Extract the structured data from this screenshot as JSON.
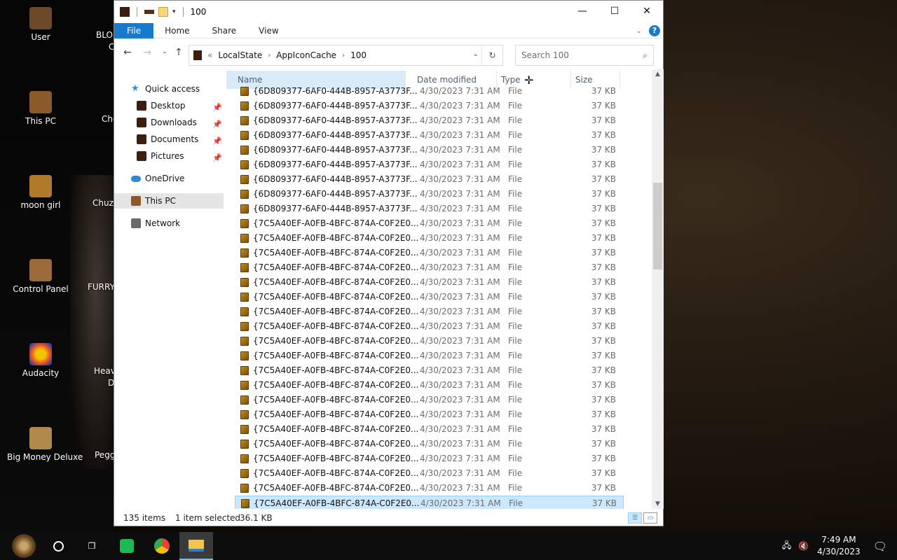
{
  "desktop": {
    "icons": [
      {
        "label": "User",
        "color": "#6b4a2a"
      },
      {
        "label": "This PC",
        "color": "#8b5a2b"
      },
      {
        "label": "moon girl",
        "color": "#b07a2a"
      },
      {
        "label": "Control Panel",
        "color": "#9a6a3a"
      },
      {
        "label": "Audacity",
        "color": "#e2502a"
      },
      {
        "label": "Big Money Deluxe",
        "color": "#b08a4a"
      }
    ],
    "clipped": [
      "BLO",
      "C",
      "Cho",
      "Chuzz",
      "FURRY",
      "Heav",
      "D",
      "Pegg"
    ]
  },
  "window": {
    "title": "100",
    "ribbon_tabs": {
      "file": "File",
      "home": "Home",
      "share": "Share",
      "view": "View"
    },
    "help": "?",
    "address": {
      "prefix": "«",
      "crumbs": [
        "LocalState",
        "AppIconCache",
        "100"
      ]
    },
    "search_placeholder": "Search 100",
    "nav": {
      "quick_access": "Quick access",
      "desktop": "Desktop",
      "downloads": "Downloads",
      "documents": "Documents",
      "pictures": "Pictures",
      "onedrive": "OneDrive",
      "this_pc": "This PC",
      "network": "Network"
    },
    "columns": {
      "name": "Name",
      "date": "Date modified",
      "type": "Type",
      "size": "Size"
    },
    "rows": [
      {
        "name": "{6D809377-6AF0-444B-8957-A3773F...",
        "date": "4/30/2023 7:31 AM",
        "type": "File",
        "size": "37 KB"
      },
      {
        "name": "{6D809377-6AF0-444B-8957-A3773F...",
        "date": "4/30/2023 7:31 AM",
        "type": "File",
        "size": "37 KB"
      },
      {
        "name": "{6D809377-6AF0-444B-8957-A3773F...",
        "date": "4/30/2023 7:31 AM",
        "type": "File",
        "size": "37 KB"
      },
      {
        "name": "{6D809377-6AF0-444B-8957-A3773F...",
        "date": "4/30/2023 7:31 AM",
        "type": "File",
        "size": "37 KB"
      },
      {
        "name": "{6D809377-6AF0-444B-8957-A3773F...",
        "date": "4/30/2023 7:31 AM",
        "type": "File",
        "size": "37 KB"
      },
      {
        "name": "{6D809377-6AF0-444B-8957-A3773F...",
        "date": "4/30/2023 7:31 AM",
        "type": "File",
        "size": "37 KB"
      },
      {
        "name": "{6D809377-6AF0-444B-8957-A3773F...",
        "date": "4/30/2023 7:31 AM",
        "type": "File",
        "size": "37 KB"
      },
      {
        "name": "{6D809377-6AF0-444B-8957-A3773F...",
        "date": "4/30/2023 7:31 AM",
        "type": "File",
        "size": "37 KB"
      },
      {
        "name": "{6D809377-6AF0-444B-8957-A3773F...",
        "date": "4/30/2023 7:31 AM",
        "type": "File",
        "size": "37 KB"
      },
      {
        "name": "{7C5A40EF-A0FB-4BFC-874A-C0F2E0...",
        "date": "4/30/2023 7:31 AM",
        "type": "File",
        "size": "37 KB"
      },
      {
        "name": "{7C5A40EF-A0FB-4BFC-874A-C0F2E0...",
        "date": "4/30/2023 7:31 AM",
        "type": "File",
        "size": "37 KB"
      },
      {
        "name": "{7C5A40EF-A0FB-4BFC-874A-C0F2E0...",
        "date": "4/30/2023 7:31 AM",
        "type": "File",
        "size": "37 KB"
      },
      {
        "name": "{7C5A40EF-A0FB-4BFC-874A-C0F2E0...",
        "date": "4/30/2023 7:31 AM",
        "type": "File",
        "size": "37 KB"
      },
      {
        "name": "{7C5A40EF-A0FB-4BFC-874A-C0F2E0...",
        "date": "4/30/2023 7:31 AM",
        "type": "File",
        "size": "37 KB"
      },
      {
        "name": "{7C5A40EF-A0FB-4BFC-874A-C0F2E0...",
        "date": "4/30/2023 7:31 AM",
        "type": "File",
        "size": "37 KB"
      },
      {
        "name": "{7C5A40EF-A0FB-4BFC-874A-C0F2E0...",
        "date": "4/30/2023 7:31 AM",
        "type": "File",
        "size": "37 KB"
      },
      {
        "name": "{7C5A40EF-A0FB-4BFC-874A-C0F2E0...",
        "date": "4/30/2023 7:31 AM",
        "type": "File",
        "size": "37 KB"
      },
      {
        "name": "{7C5A40EF-A0FB-4BFC-874A-C0F2E0...",
        "date": "4/30/2023 7:31 AM",
        "type": "File",
        "size": "37 KB"
      },
      {
        "name": "{7C5A40EF-A0FB-4BFC-874A-C0F2E0...",
        "date": "4/30/2023 7:31 AM",
        "type": "File",
        "size": "37 KB"
      },
      {
        "name": "{7C5A40EF-A0FB-4BFC-874A-C0F2E0...",
        "date": "4/30/2023 7:31 AM",
        "type": "File",
        "size": "37 KB"
      },
      {
        "name": "{7C5A40EF-A0FB-4BFC-874A-C0F2E0...",
        "date": "4/30/2023 7:31 AM",
        "type": "File",
        "size": "37 KB"
      },
      {
        "name": "{7C5A40EF-A0FB-4BFC-874A-C0F2E0...",
        "date": "4/30/2023 7:31 AM",
        "type": "File",
        "size": "37 KB"
      },
      {
        "name": "{7C5A40EF-A0FB-4BFC-874A-C0F2E0...",
        "date": "4/30/2023 7:31 AM",
        "type": "File",
        "size": "37 KB"
      },
      {
        "name": "{7C5A40EF-A0FB-4BFC-874A-C0F2E0...",
        "date": "4/30/2023 7:31 AM",
        "type": "File",
        "size": "37 KB"
      },
      {
        "name": "{7C5A40EF-A0FB-4BFC-874A-C0F2E0...",
        "date": "4/30/2023 7:31 AM",
        "type": "File",
        "size": "37 KB"
      },
      {
        "name": "{7C5A40EF-A0FB-4BFC-874A-C0F2E0...",
        "date": "4/30/2023 7:31 AM",
        "type": "File",
        "size": "37 KB"
      },
      {
        "name": "{7C5A40EF-A0FB-4BFC-874A-C0F2E0...",
        "date": "4/30/2023 7:31 AM",
        "type": "File",
        "size": "37 KB"
      },
      {
        "name": "{7C5A40EF-A0FB-4BFC-874A-C0F2E0...",
        "date": "4/30/2023 7:31 AM",
        "type": "File",
        "size": "37 KB"
      },
      {
        "name": "{7C5A40EF-A0FB-4BFC-874A-C0F2E0...",
        "date": "4/30/2023 7:31 AM",
        "type": "File",
        "size": "37 KB"
      }
    ],
    "selected_row": 28,
    "status": {
      "count": "135 items",
      "selected": "1 item selected",
      "size": "36.1 KB"
    }
  },
  "taskbar": {
    "time": "7:49 AM",
    "date": "4/30/2023"
  },
  "colors": {
    "accent": "#1979ca",
    "selection": "#cce8ff",
    "folder": "#c48a1c"
  }
}
